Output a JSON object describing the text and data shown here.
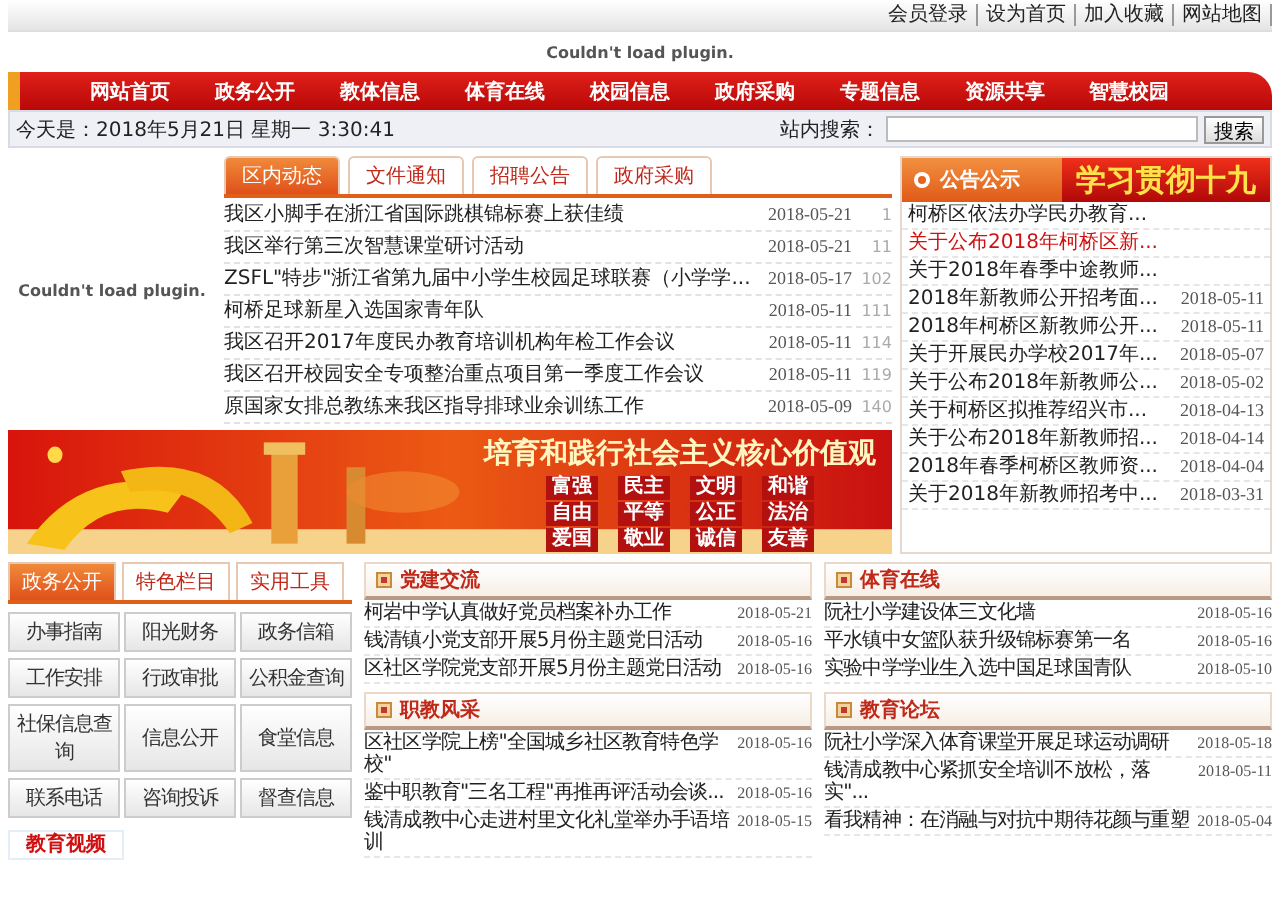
{
  "top_links": [
    "会员登录",
    "设为首页",
    "加入收藏",
    "网站地图"
  ],
  "header_plugin": {
    "message": "Couldn't load plugin."
  },
  "nav": [
    "网站首页",
    "政务公开",
    "教体信息",
    "体育在线",
    "校园信息",
    "政府采购",
    "专题信息",
    "资源共享",
    "智慧校园"
  ],
  "date_text": "今天是：2018年5月21日 星期一 3:30:41",
  "search": {
    "label": "站内搜索：",
    "button": "搜索"
  },
  "side_plugin": {
    "message": "Couldn't load plugin."
  },
  "news_tabs": [
    {
      "label": "区内动态",
      "selected": true
    },
    {
      "label": "文件通知",
      "selected": false
    },
    {
      "label": "招聘公告",
      "selected": false
    },
    {
      "label": "政府采购",
      "selected": false
    }
  ],
  "news": [
    {
      "title": "我区小脚手在浙江省国际跳棋锦标赛上获佳绩",
      "date": "2018-05-21",
      "count": "1"
    },
    {
      "title": "我区举行第三次智慧课堂研讨活动",
      "date": "2018-05-21",
      "count": "11"
    },
    {
      "title": "ZSFL\"特步\"浙江省第九届中小学生校园足球联赛（小学学...",
      "date": "2018-05-17",
      "count": "102"
    },
    {
      "title": "柯桥足球新星入选国家青年队",
      "date": "2018-05-11",
      "count": "111"
    },
    {
      "title": "我区召开2017年度民办教育培训机构年检工作会议",
      "date": "2018-05-11",
      "count": "114"
    },
    {
      "title": "我区召开校园安全专项整治重点项目第一季度工作会议",
      "date": "2018-05-11",
      "count": "119"
    },
    {
      "title": "原国家女排总教练来我区指导排球业余训练工作",
      "date": "2018-05-09",
      "count": "140"
    }
  ],
  "notices": {
    "title": "公告公示",
    "items": [
      {
        "title": "柯桥区依法办学民办教育...",
        "highlighted": false
      },
      {
        "title": "关于公布2018年柯桥区新...",
        "highlighted": true
      },
      {
        "title": "关于2018年春季中途教师...",
        "highlighted": false
      },
      {
        "title": "2018年新教师公开招考面...",
        "date": "2018-05-11",
        "highlighted": false
      },
      {
        "title": "2018年柯桥区新教师公开...",
        "date": "2018-05-11",
        "highlighted": false
      },
      {
        "title": "关于开展民办学校2017年...",
        "date": "2018-05-07",
        "highlighted": false
      },
      {
        "title": "关于公布2018年新教师公...",
        "date": "2018-05-02",
        "highlighted": false
      },
      {
        "title": "关于柯桥区拟推荐绍兴市...",
        "date": "2018-04-13",
        "highlighted": false
      },
      {
        "title": "关于公布2018年新教师招...",
        "date": "2018-04-14",
        "highlighted": false
      },
      {
        "title": "2018年春季柯桥区教师资...",
        "date": "2018-04-04",
        "highlighted": false
      },
      {
        "title": "关于2018年新教师招考中...",
        "date": "2018-03-31",
        "highlighted": false
      }
    ]
  },
  "ad": {
    "text": "学习贯彻十九"
  },
  "banner": {
    "slogan": "培育和践行社会主义核心价值观",
    "values": [
      "富强",
      "民主",
      "文明",
      "和谐",
      "自由",
      "平等",
      "公正",
      "法治",
      "爱国",
      "敬业",
      "诚信",
      "友善"
    ]
  },
  "tool_tabs": [
    {
      "label": "政务公开",
      "selected": true
    },
    {
      "label": "特色栏目",
      "selected": false
    },
    {
      "label": "实用工具",
      "selected": false
    }
  ],
  "tools": [
    "办事指南",
    "阳光财务",
    "政务信箱",
    "工作安排",
    "行政审批",
    "公积金查询",
    "社保信息查询",
    "信息公开",
    "食堂信息",
    "联系电话",
    "咨询投诉",
    "督查信息"
  ],
  "sections": [
    {
      "title": "党建交流",
      "items": [
        {
          "title": "柯岩中学认真做好党员档案补办工作",
          "date": "2018-05-21"
        },
        {
          "title": "钱清镇小党支部开展5月份主题党日活动",
          "date": "2018-05-16"
        },
        {
          "title": "区社区学院党支部开展5月份主题党日活动",
          "date": "2018-05-16"
        }
      ]
    },
    {
      "title": "体育在线",
      "items": [
        {
          "title": "阮社小学建设体三文化墙",
          "date": "2018-05-16"
        },
        {
          "title": "平水镇中女篮队获升级锦标赛第一名",
          "date": "2018-05-16"
        },
        {
          "title": "实验中学学业生入选中国足球国青队",
          "date": "2018-05-10"
        }
      ]
    },
    {
      "title": "职教风采",
      "items": [
        {
          "title": "区社区学院上榜\"全国城乡社区教育特色学校\"",
          "date": "2018-05-16"
        },
        {
          "title": "鉴中职教育\"三名工程\"再推再评活动会谈...",
          "date": "2018-05-16"
        },
        {
          "title": "钱清成教中心走进村里文化礼堂举办手语培训",
          "date": "2018-05-15"
        }
      ]
    },
    {
      "title": "教育论坛",
      "items": [
        {
          "title": "阮社小学深入体育课堂开展足球运动调研",
          "date": "2018-05-18"
        },
        {
          "title": "钱清成教中心紧抓安全培训不放松，落实\"...",
          "date": "2018-05-11"
        },
        {
          "title": "看我精神：在消融与对抗中期待花颜与重塑",
          "date": "2018-05-04"
        }
      ]
    }
  ],
  "video_title": "教育视频"
}
